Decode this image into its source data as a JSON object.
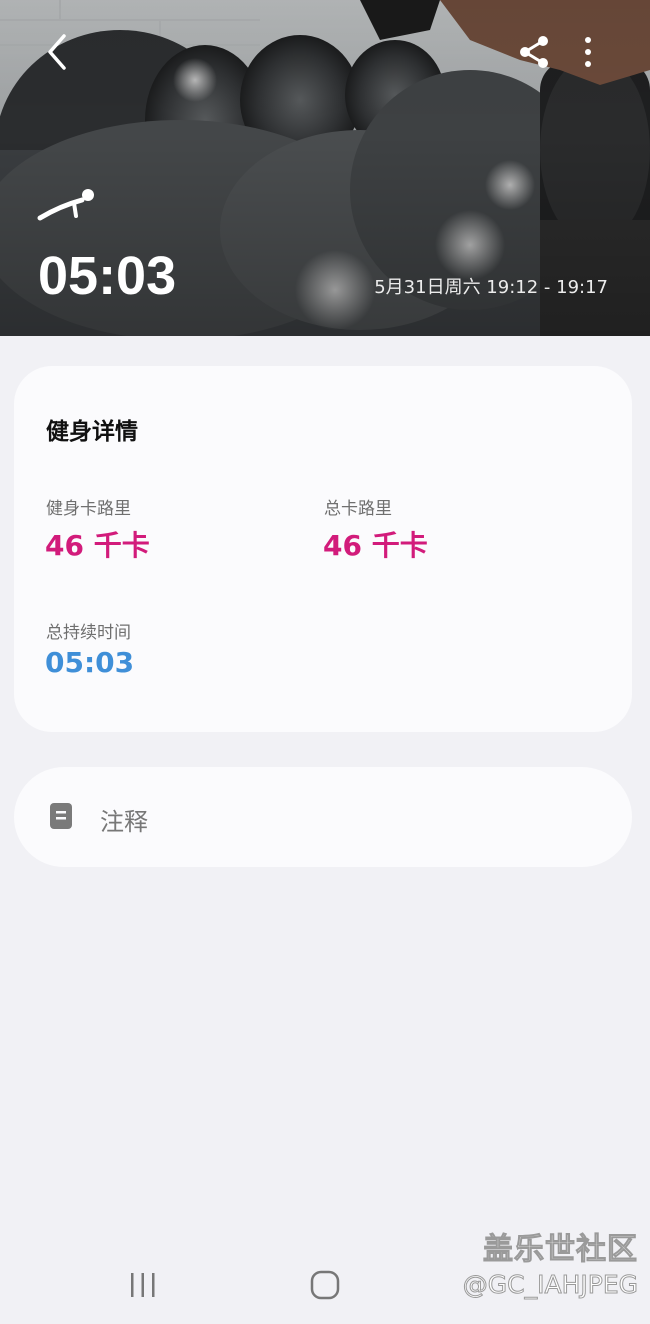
{
  "header": {
    "duration": "05:03",
    "datetime": "5月31日周六 19:12 - 19:17",
    "back_icon": "chevron-left-icon",
    "share_icon": "share-icon",
    "more_icon": "more-vertical-icon",
    "workout_icon": "workout-type-icon"
  },
  "details": {
    "title": "健身详情",
    "metrics": [
      {
        "label": "健身卡路里",
        "value": "46 千卡",
        "color": "#d21b7b"
      },
      {
        "label": "总卡路里",
        "value": "46 千卡",
        "color": "#d21b7b"
      },
      {
        "label": "总持续时间",
        "value": "05:03",
        "color": "#3f8fd8"
      }
    ]
  },
  "notes": {
    "icon": "note-icon",
    "label": "注释"
  },
  "navbar": {
    "recent_icon": "recent-apps-icon",
    "home_icon": "home-icon"
  },
  "watermark": {
    "title": "盖乐世社区",
    "subtitle": "@GC_IAHJPEG"
  }
}
